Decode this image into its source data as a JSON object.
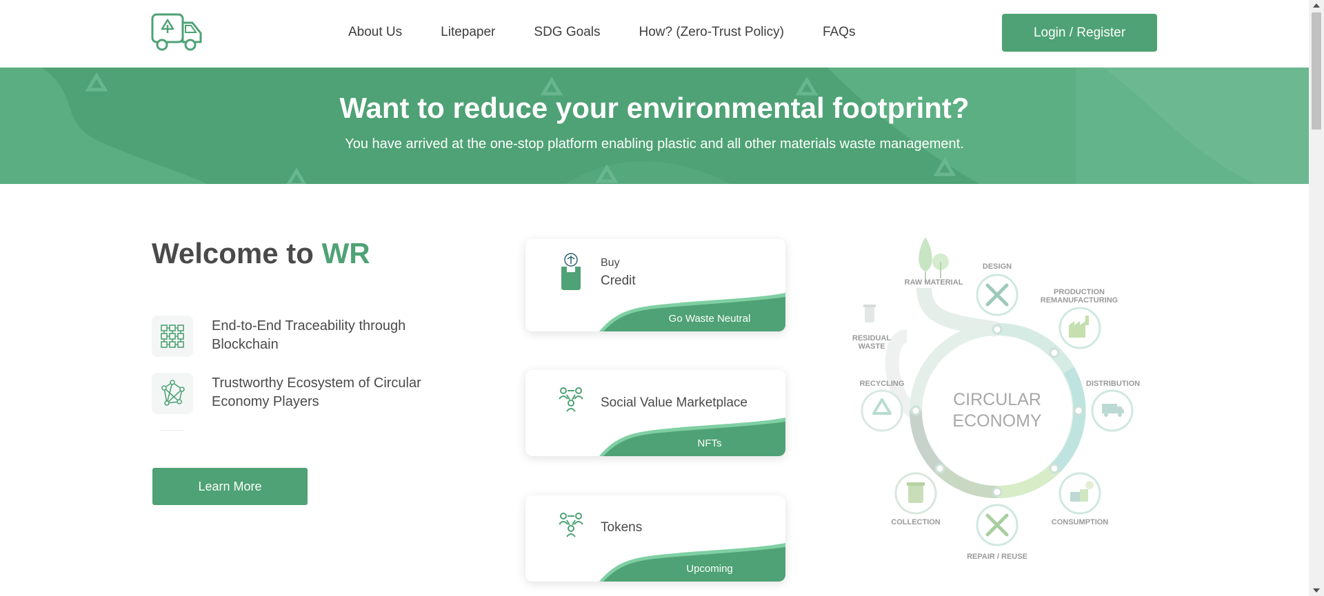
{
  "header": {
    "logo_name": "recycling-truck-logo",
    "nav": [
      "About Us",
      "Litepaper",
      "SDG Goals",
      "How? (Zero-Trust Policy)",
      "FAQs"
    ],
    "login_label": "Login / Register"
  },
  "banner": {
    "title": "Want to reduce your environmental footprint?",
    "subtitle": "You have arrived at the one-stop platform enabling plastic and all other materials waste management."
  },
  "welcome": {
    "title_prefix": "Welcome to ",
    "title_accent": "WR",
    "features": [
      {
        "text": "End-to-End Traceability through Blockchain",
        "icon": "blockchain-grid-icon"
      },
      {
        "text": "Trustworthy Ecosystem of Circular Economy Players",
        "icon": "network-icon"
      }
    ],
    "learn_more_label": "Learn More"
  },
  "cards": [
    {
      "small": "Buy",
      "label": "Credit",
      "tag": "Go Waste Neutral",
      "icon": "credit-bag-icon"
    },
    {
      "label": "Social Value Marketplace",
      "tag": "NFTs",
      "icon": "people-network-icon"
    },
    {
      "label": "Tokens",
      "tag": "Upcoming",
      "icon": "people-network-icon"
    }
  ],
  "circular": {
    "center_line1": "CIRCULAR",
    "center_line2": "ECONOMY",
    "raw_material": "RAW MATERIAL",
    "design": "DESIGN",
    "production_1": "PRODUCTION",
    "production_2": "REMANUFACTURING",
    "distribution": "DISTRIBUTION",
    "consumption": "CONSUMPTION",
    "repair": "REPAIR / REUSE",
    "collection": "COLLECTION",
    "recycling": "RECYCLING",
    "residual_1": "RESIDUAL",
    "residual_2": "WASTE"
  },
  "colors": {
    "brand_green": "#4ea275",
    "text_dark": "#4a4a4a",
    "white": "#ffffff"
  }
}
